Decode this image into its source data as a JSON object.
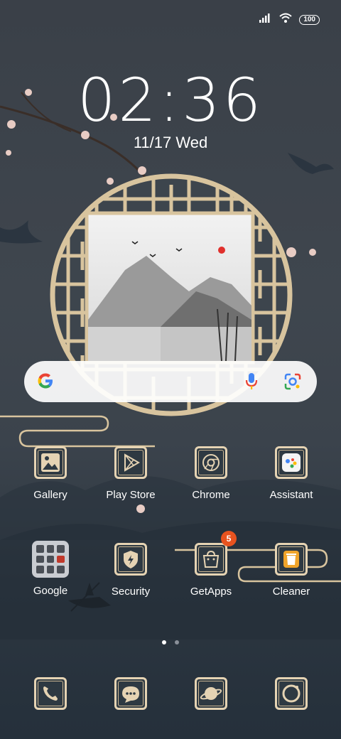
{
  "status": {
    "battery": "100"
  },
  "clock": {
    "time": "02:36",
    "date": "11/17 Wed"
  },
  "search": {
    "g_letter": "G"
  },
  "apps_row1": [
    {
      "label": "Gallery"
    },
    {
      "label": "Play Store"
    },
    {
      "label": "Chrome"
    },
    {
      "label": "Assistant"
    }
  ],
  "apps_row2": [
    {
      "label": "Google"
    },
    {
      "label": "Security"
    },
    {
      "label": "GetApps",
      "badge": "5"
    },
    {
      "label": "Cleaner"
    }
  ],
  "colors": {
    "accent": "#e5d3b3",
    "badge": "#e8531f",
    "background": "#3a4048"
  }
}
